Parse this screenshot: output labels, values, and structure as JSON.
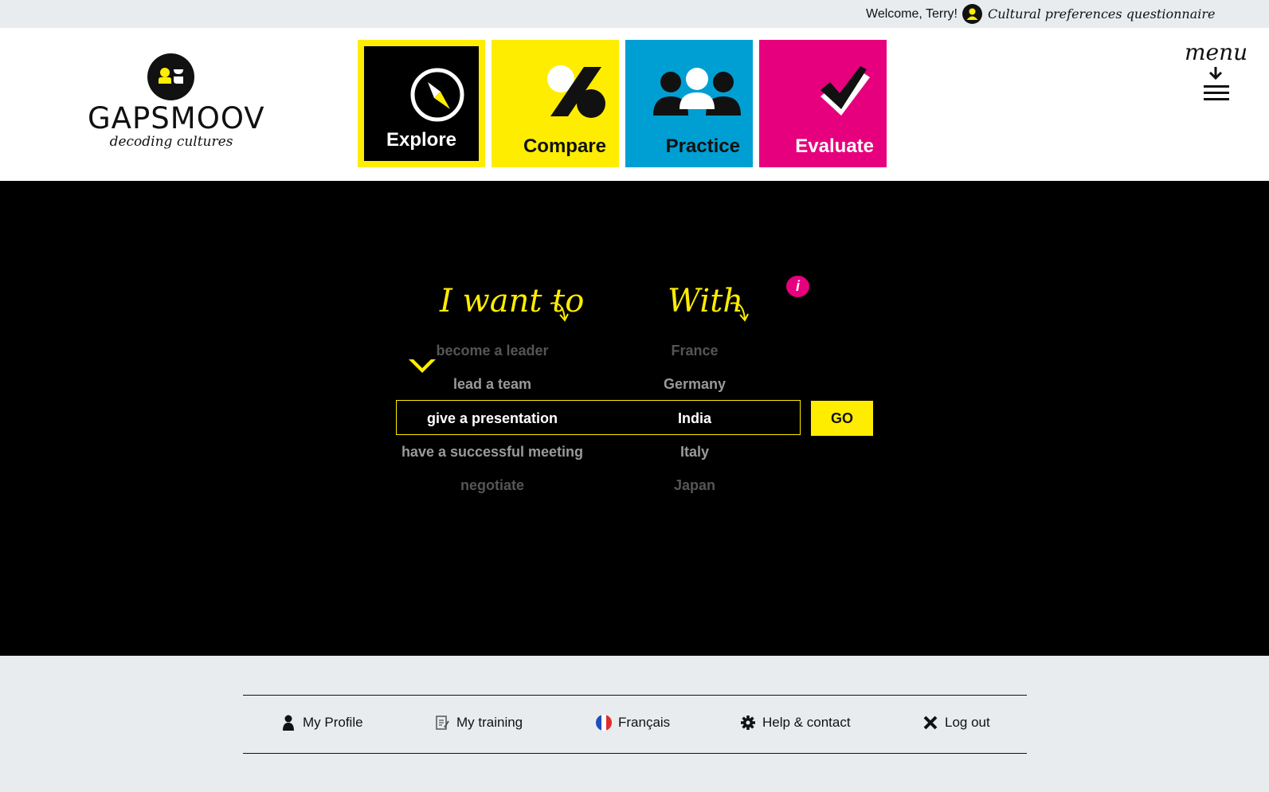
{
  "topbar": {
    "welcome": "Welcome, Terry!",
    "questionnaire_link": "Cultural preferences questionnaire"
  },
  "logo": {
    "name": "GAPSMOOV",
    "tagline": "decoding cultures"
  },
  "nav": {
    "tiles": [
      {
        "label": "Explore",
        "color": "#ffed00",
        "active": true
      },
      {
        "label": "Compare",
        "color": "#ffed00"
      },
      {
        "label": "Practice",
        "color": "#009fd3"
      },
      {
        "label": "Evaluate",
        "color": "#e6007e"
      }
    ],
    "menu_label": "menu"
  },
  "selector": {
    "want_heading": "I want to",
    "with_heading": "With",
    "info_icon": "i",
    "actions": [
      "become a leader",
      "lead a team",
      "give a presentation",
      "have a successful meeting",
      "negotiate"
    ],
    "countries": [
      "France",
      "Germany",
      "India",
      "Italy",
      "Japan"
    ],
    "go_label": "GO"
  },
  "footer": {
    "items": [
      {
        "label": "My Profile",
        "icon": "person-icon"
      },
      {
        "label": "My training",
        "icon": "training-icon"
      },
      {
        "label": "Français",
        "icon": "french-flag-icon"
      },
      {
        "label": "Help & contact",
        "icon": "gear-icon"
      },
      {
        "label": "Log out",
        "icon": "close-icon"
      }
    ]
  },
  "colors": {
    "yellow": "#ffed00",
    "blue": "#009fd3",
    "magenta": "#e6007e",
    "black": "#000000",
    "footer_bg": "#e8ecef"
  }
}
